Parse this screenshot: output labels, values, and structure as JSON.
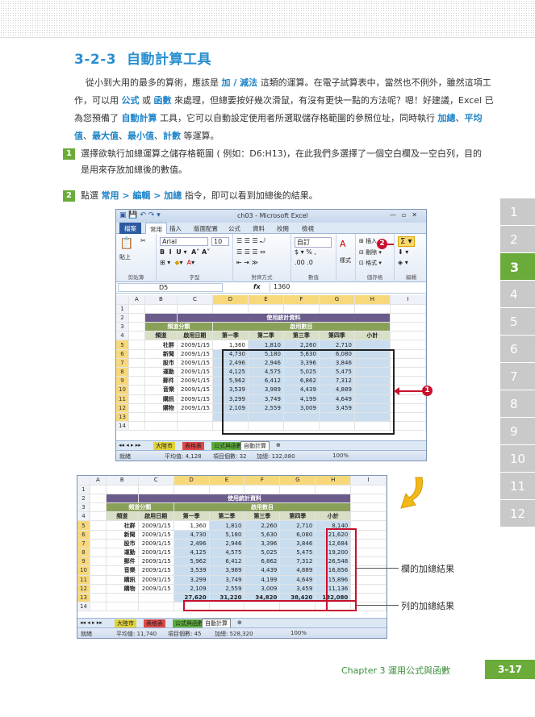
{
  "section": {
    "number": "3-2-3",
    "title": "自動計算工具"
  },
  "intro": {
    "p1": "從小到大用的最多的算術，應該是",
    "k1": "加 / 減法",
    "p2": "這類的運算。在電子試算表中，當然也不例外，雖然這項工作，可以用",
    "k2": "公式",
    "p3": "或",
    "k3": "函數",
    "p4": "來處理，但總要按好幾次滑鼠，有沒有更快一點的方法呢？嗯！好建議，Excel 已為您預備了",
    "k4": "自動計算",
    "p5": "工具，它可以自動設定使用者所選取儲存格範圍的參照位址，同時執行",
    "k5": "加總",
    "s1": "、",
    "k6": "平均值",
    "s2": "、",
    "k7": "最大值",
    "s3": "、",
    "k8": "最小值",
    "s4": "、",
    "k9": "計數",
    "p6": "等運算。"
  },
  "step1": {
    "num": "1",
    "text": "選擇欲執行加總運算之儲存格範圍 ( 例如：D6:H13)，在此我們多選擇了一個空白欄及一空白列，目的是用來存放加總後的數值。"
  },
  "step2": {
    "num": "2",
    "a": "點選",
    "menu": "常用 > 編輯 > 加總",
    "b": "指令，即可以看到加總後的結果。"
  },
  "chapter_tabs": [
    "1",
    "2",
    "3",
    "4",
    "5",
    "6",
    "7",
    "8",
    "9",
    "10",
    "11",
    "12"
  ],
  "active_tab": "3",
  "excel": {
    "title": "ch03 - Microsoft Excel",
    "tabs": [
      "檔案",
      "常用",
      "插入",
      "版面配置",
      "公式",
      "資料",
      "校閱",
      "檢視"
    ],
    "font_name": "Arial",
    "font_size": "10",
    "number_format": "自訂",
    "groups": [
      "剪貼簿",
      "字型",
      "對齊方式",
      "數值",
      "儲存格",
      "編輯"
    ],
    "paste": "貼上",
    "style": "樣式",
    "cells_insert": "插入",
    "cells_delete": "刪除",
    "cells_format": "格式",
    "name_box": "D5",
    "fx": "fx",
    "formula": "1360",
    "col_headers": [
      "A",
      "B",
      "C",
      "D",
      "E",
      "F",
      "G",
      "H",
      "I"
    ],
    "sheet_tabs": [
      "大陸市",
      "表格表",
      "公式與函數",
      "自動計算"
    ],
    "status_ready": "就緒",
    "status1": {
      "avg": "平均值: 4,128",
      "count": "項目個數: 32",
      "sum": "加總: 132,080",
      "zoom": "100%"
    },
    "status2": {
      "avg": "平均值: 11,740",
      "count": "項目個數: 45",
      "sum": "加總: 528,320",
      "zoom": "100%"
    }
  },
  "table": {
    "title": "使用統計資料",
    "group_left": "頻道分類",
    "group_right": "啟用數目",
    "headers": [
      "頻道",
      "啟用日期",
      "第一季",
      "第二季",
      "第三季",
      "第四季",
      "小計"
    ],
    "rows": [
      {
        "cat": "社群",
        "date": "2009/1/15",
        "q": [
          "1,360",
          "1,810",
          "2,260",
          "2,710"
        ],
        "sub": "8,140"
      },
      {
        "cat": "新聞",
        "date": "2009/1/15",
        "q": [
          "4,730",
          "5,180",
          "5,630",
          "6,080"
        ],
        "sub": "21,620"
      },
      {
        "cat": "股市",
        "date": "2009/1/15",
        "q": [
          "2,496",
          "2,946",
          "3,396",
          "3,846"
        ],
        "sub": "12,684"
      },
      {
        "cat": "運動",
        "date": "2009/1/15",
        "q": [
          "4,125",
          "4,575",
          "5,025",
          "5,475"
        ],
        "sub": "19,200"
      },
      {
        "cat": "郵件",
        "date": "2009/1/15",
        "q": [
          "5,962",
          "6,412",
          "6,862",
          "7,312"
        ],
        "sub": "26,548"
      },
      {
        "cat": "音樂",
        "date": "2009/1/15",
        "q": [
          "3,539",
          "3,989",
          "4,439",
          "4,889"
        ],
        "sub": "16,856"
      },
      {
        "cat": "購訊",
        "date": "2009/1/15",
        "q": [
          "3,299",
          "3,749",
          "4,199",
          "4,649"
        ],
        "sub": "15,896"
      },
      {
        "cat": "購物",
        "date": "2009/1/15",
        "q": [
          "2,109",
          "2,559",
          "3,009",
          "3,459"
        ],
        "sub": "11,136"
      }
    ],
    "totals": [
      "27,620",
      "31,220",
      "34,820",
      "38,420",
      "132,080"
    ]
  },
  "callouts": {
    "badge1": "1",
    "badge2": "2",
    "col_result": "欄的加總結果",
    "row_result": "列的加總結果"
  },
  "footer": {
    "chapter": "Chapter 3  運用公式與函數",
    "page": "3-17"
  }
}
